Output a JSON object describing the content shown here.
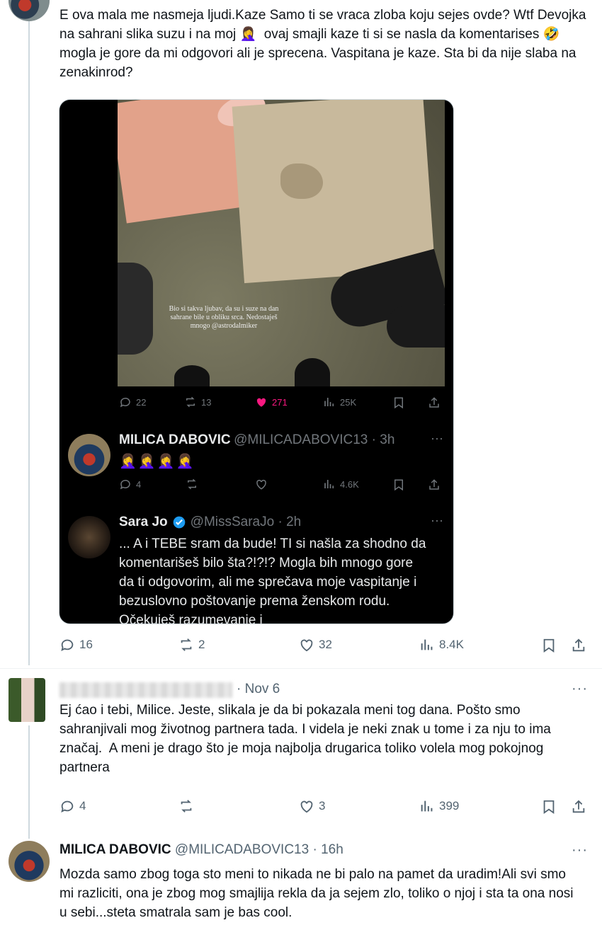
{
  "tweet1": {
    "text": "E ova mala me nasmeja ljudi.Kaze Samo ti se vraca zloba koju sejes ovde? Wtf Devojka na sahrani slika suzu i na moj 🤦‍♀️  ovaj smajli kaze ti si se nasla da komentarises 🤣 mogla je gore da mi odgovori ali je sprecena. Vaspitana je kaze. Sta bi da nije slaba na zenakinrod?",
    "stats": {
      "replies": "16",
      "reposts": "2",
      "likes": "32",
      "views": "8.4K"
    }
  },
  "screenshot": {
    "overlay_text": "Bio si takva ljubav, da su i suze na dan sahrane bile u obliku srca. Nedostaješ mnogo @astrodalmiker",
    "post_stats": {
      "replies": "22",
      "reposts": "13",
      "likes": "271",
      "views": "25K"
    },
    "reply1": {
      "name": "MILICA DABOVIC",
      "handle": "@MILICADABOVIC13 · 3h",
      "emojis": "🤦‍♀️🤦‍♀️🤦‍♀️🤦‍♀️",
      "stats": {
        "replies": "4",
        "reposts": "",
        "likes": "",
        "views": "4.6K"
      }
    },
    "reply2": {
      "name": "Sara Jo",
      "handle": "@MissSaraJo · 2h",
      "text": "... A i TEBE sram da bude! TI si našla za shodno da komentarišeš bilo šta?!?!? Mogla bih mnogo gore da ti odgovorim, ali me sprečava moje vaspitanje i bezuslovno poštovanje prema ženskom rodu. Očekuješ razumevanje i"
    }
  },
  "tweet2": {
    "date": "· Nov 6",
    "text": "Ej ćao i tebi, Milice. Jeste, slikala je da bi pokazala meni tog dana. Pošto smo sahranjivali mog životnog partnera tada. I videla je neki znak u tome i za nju to ima značaj.  A meni je drago što je moja najbolja drugarica toliko volela mog pokojnog partnera",
    "stats": {
      "replies": "4",
      "reposts": "",
      "likes": "3",
      "views": "399"
    }
  },
  "tweet3": {
    "name": "MILICA DABOVIC",
    "handle": "@MILICADABOVIC13 · 16h",
    "text": "Mozda samo zbog toga sto meni to nikada ne bi palo na pamet da uradim!Ali svi smo mi razliciti, ona je zbog mog smajlija rekla da ja sejem zlo, toliko o njoj i sta ta ona nosi u sebi...steta smatrala sam je bas cool."
  },
  "more_label": "···",
  "colors": {
    "like_pink": "#f91880",
    "muted": "#536471",
    "line": "#cfd9de"
  }
}
